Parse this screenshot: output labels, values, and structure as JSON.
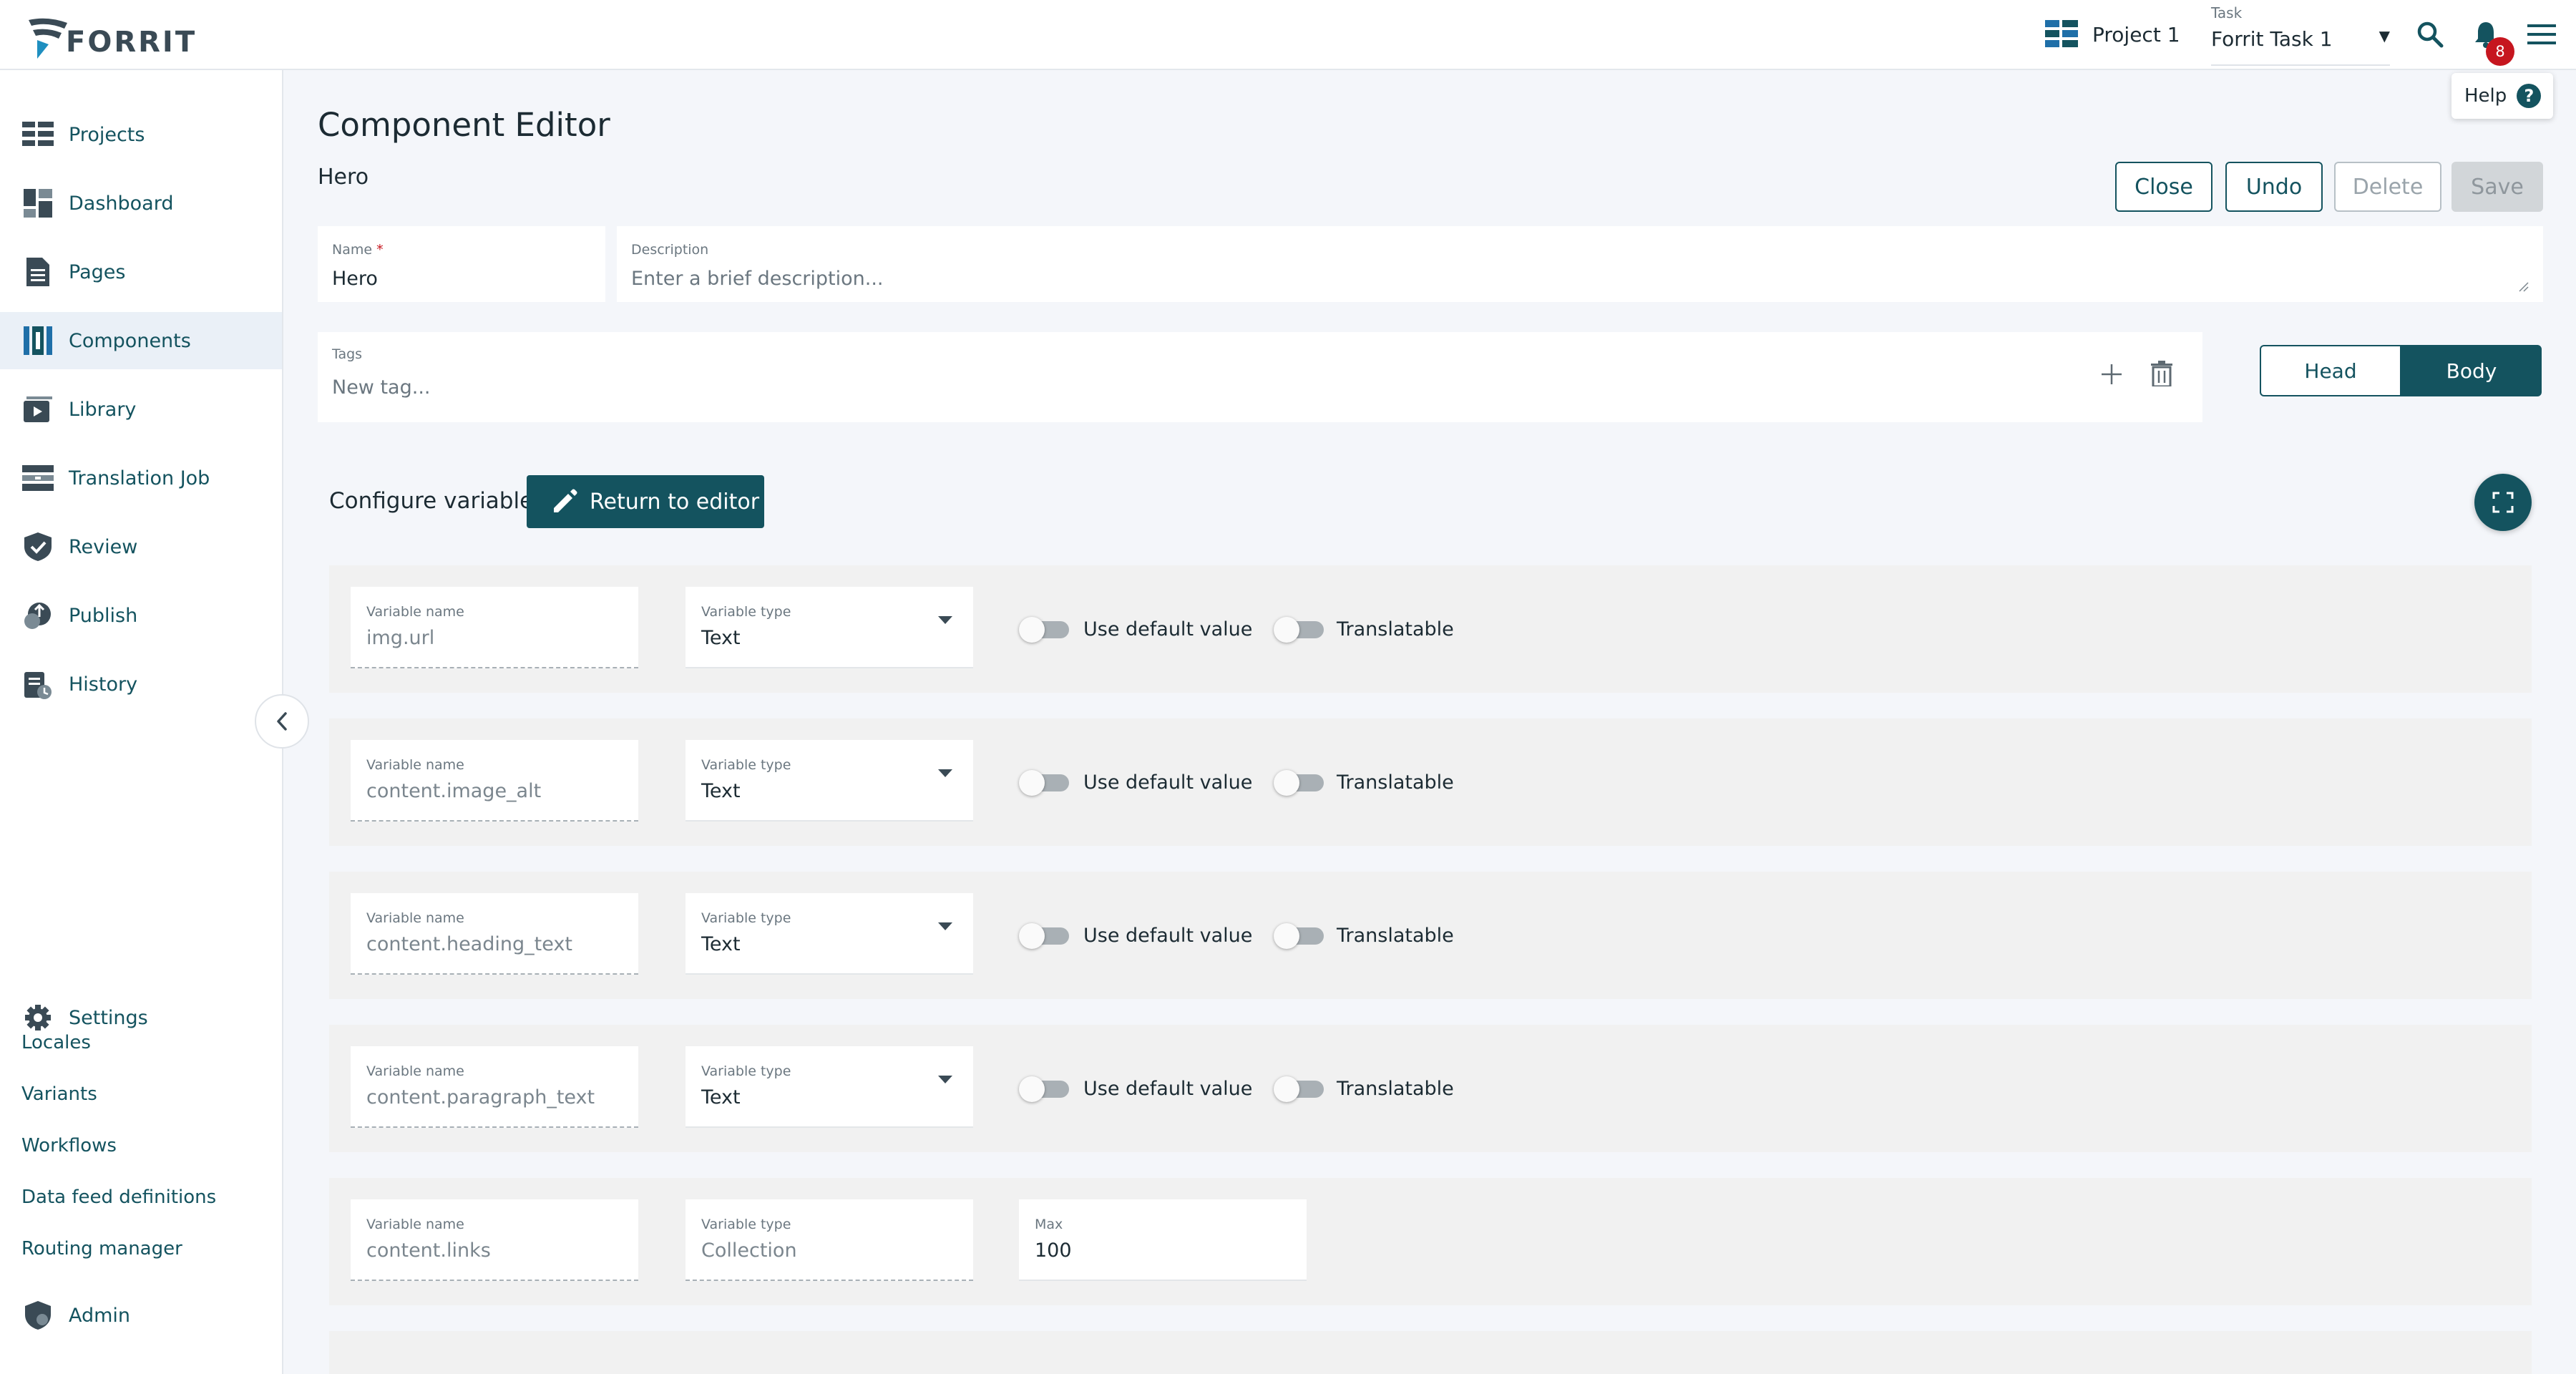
{
  "brand": {
    "name": "FORRIT"
  },
  "header": {
    "project": "Project 1",
    "task_label": "Task",
    "task_value": "Forrit Task 1",
    "notification_count": "8",
    "help_label": "Help",
    "help_glyph": "?"
  },
  "sidebar": {
    "items": [
      {
        "label": "Projects",
        "icon": "projects-icon"
      },
      {
        "label": "Dashboard",
        "icon": "dashboard-icon"
      },
      {
        "label": "Pages",
        "icon": "pages-icon"
      },
      {
        "label": "Components",
        "icon": "components-icon",
        "active": true
      },
      {
        "label": "Library",
        "icon": "library-icon"
      },
      {
        "label": "Translation Job",
        "icon": "translation-job-icon"
      },
      {
        "label": "Review",
        "icon": "review-icon"
      },
      {
        "label": "Publish",
        "icon": "publish-icon"
      },
      {
        "label": "History",
        "icon": "history-icon"
      }
    ],
    "settings_label": "Settings",
    "links": [
      "Locales",
      "Variants",
      "Workflows",
      "Data feed definitions",
      "Routing manager"
    ],
    "admin_label": "Admin"
  },
  "editor": {
    "title": "Component Editor",
    "subtitle": "Hero",
    "buttons": {
      "close": "Close",
      "undo": "Undo",
      "delete": "Delete",
      "save": "Save"
    },
    "name_label": "Name",
    "name_required": "*",
    "name_value": "Hero",
    "description_label": "Description",
    "description_placeholder": "Enter a brief description...",
    "tags_label": "Tags",
    "tags_placeholder": "New tag...",
    "head_label": "Head",
    "body_label": "Body",
    "configure_label": "Configure variables",
    "return_label": "Return to editor"
  },
  "variables": {
    "name_label": "Variable name",
    "type_label": "Variable type",
    "use_default_label": "Use default value",
    "translatable_label": "Translatable",
    "max_label": "Max",
    "rows": [
      {
        "name": "img.url",
        "type": "Text"
      },
      {
        "name": "content.image_alt",
        "type": "Text"
      },
      {
        "name": "content.heading_text",
        "type": "Text"
      },
      {
        "name": "content.paragraph_text",
        "type": "Text"
      },
      {
        "name": "content.links",
        "type": "Collection",
        "max": "100"
      }
    ]
  },
  "colors": {
    "accent": "#14535f",
    "badge": "#c6161f",
    "link": "#14535f"
  }
}
